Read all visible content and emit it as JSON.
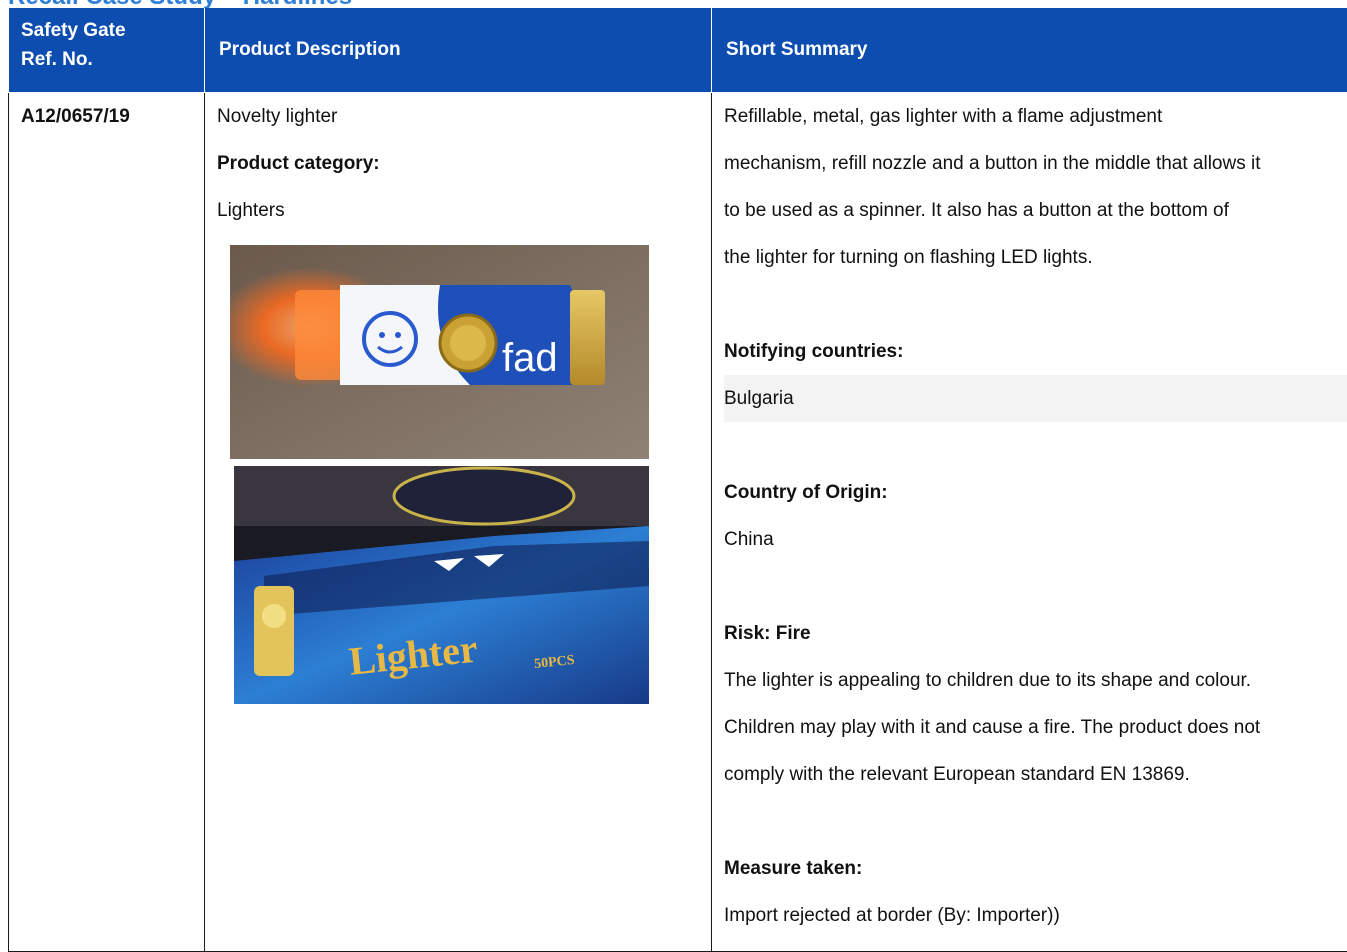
{
  "page_title": "Recall Case Study – Hardlines",
  "table": {
    "headers": {
      "ref_line1": "Safety Gate",
      "ref_line2": "Ref. No.",
      "description": "Product Description",
      "summary": "Short Summary"
    },
    "row": {
      "ref_no": "A12/0657/19",
      "product_name": "Novelty lighter",
      "category_label": "Product category:",
      "category_value": "Lighters",
      "photo1": {
        "printed_text": "fad"
      },
      "photo2": {
        "printed_text": "Lighter",
        "printed_subtext": "50PCS"
      },
      "summary_lines": [
        "Refillable, metal, gas lighter with a flame adjustment",
        "mechanism, refill nozzle and a button in the middle that allows it",
        "to be used as a spinner. It also has a button at the bottom of",
        "the lighter for turning on flashing LED lights."
      ],
      "notifying_label": "Notifying countries:",
      "notifying_value": "Bulgaria",
      "origin_label": "Country of Origin:",
      "origin_value": "China",
      "risk_label": "Risk: Fire",
      "risk_lines": [
        "The lighter is appealing to children due to its shape and colour.",
        "Children may play with it and cause a fire. The product does not",
        "comply with the relevant European standard EN 13869."
      ],
      "measure_label": "Measure taken:",
      "measure_value": "Import rejected at border (By: Importer))"
    }
  },
  "colors": {
    "header_bg": "#0d4db0",
    "header_text": "#ffffff",
    "title": "#2f7fd6",
    "border": "#1a1a1a"
  }
}
